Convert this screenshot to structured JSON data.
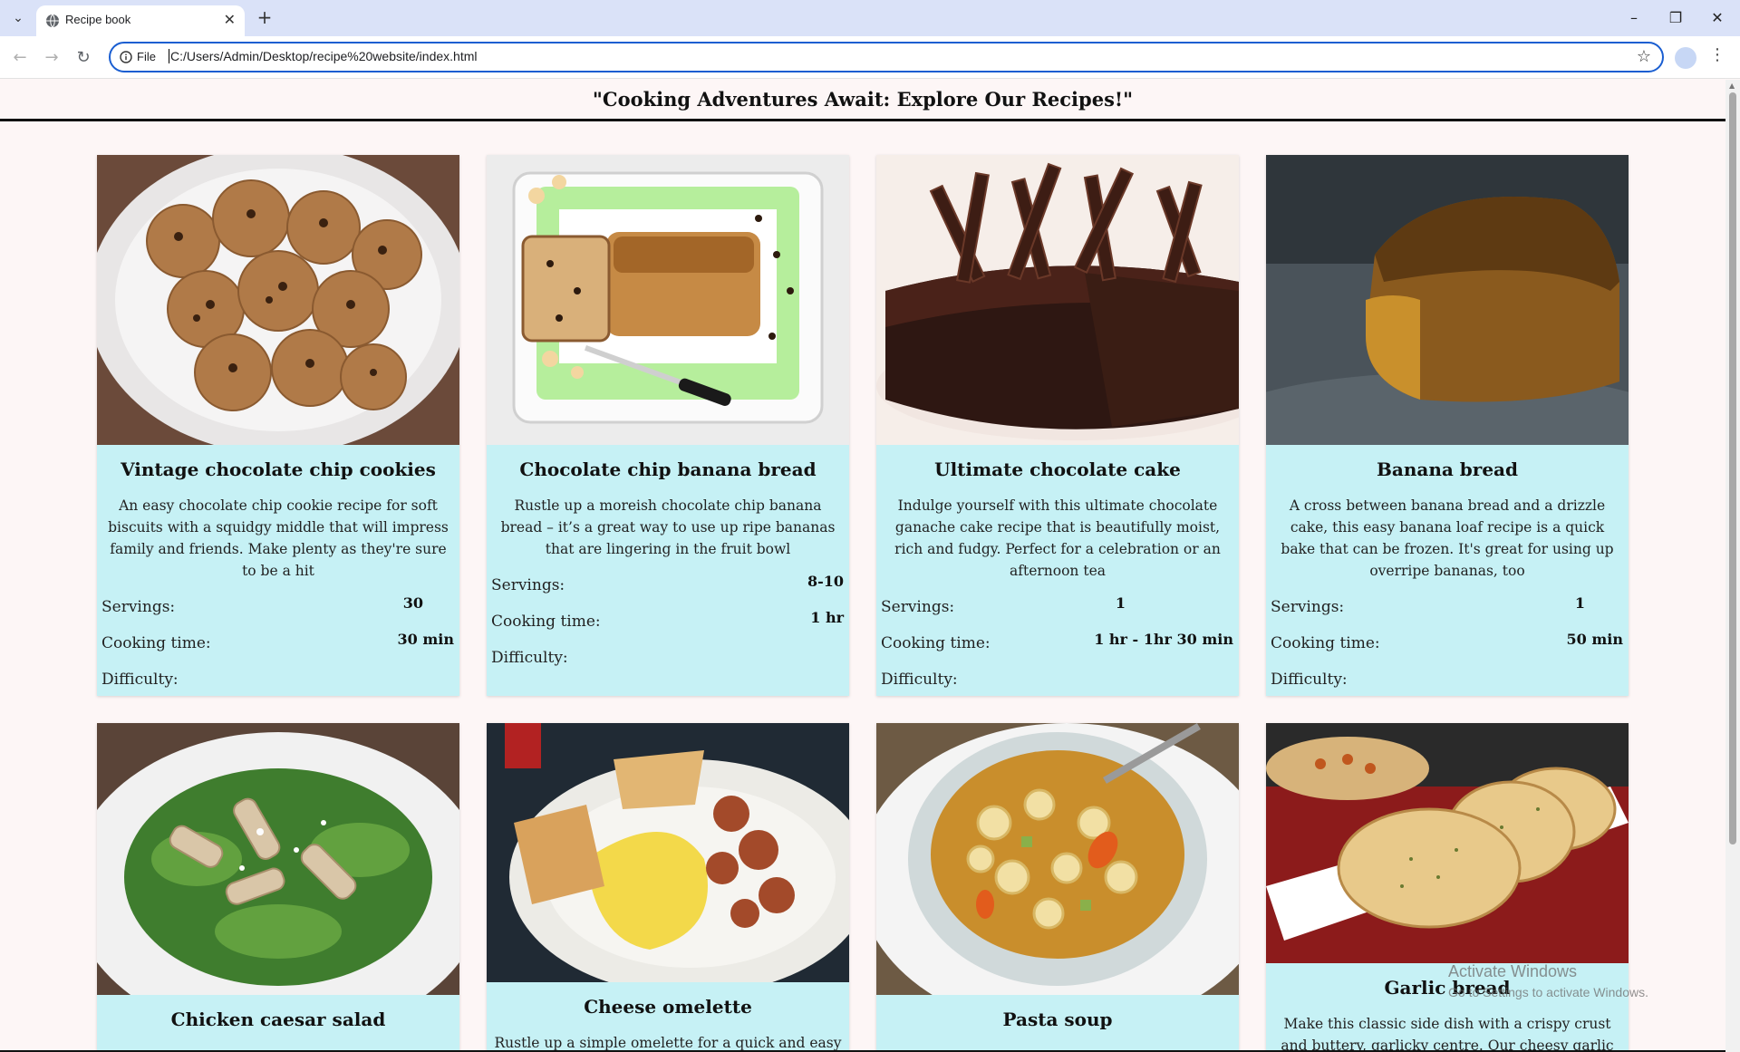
{
  "browser": {
    "tab_title": "Recipe book",
    "scheme_label": "File",
    "url": "C:/Users/Admin/Desktop/recipe%20website/index.html"
  },
  "site": {
    "title": "\"Cooking Adventures Await: Explore Our Recipes!\""
  },
  "labels": {
    "servings": "Servings:",
    "cooking_time": "Cooking time:",
    "difficulty": "Difficulty:"
  },
  "recipes": [
    {
      "title": "Vintage chocolate chip cookies",
      "description": "An easy chocolate chip cookie recipe for soft biscuits with a squidgy middle that will impress family and friends. Make plenty as they're sure to be a hit",
      "servings": "30",
      "cooking_time": "30 min",
      "image": "cookies-photo"
    },
    {
      "title": "Chocolate chip banana bread",
      "description": "Rustle up a moreish chocolate chip banana bread – it’s a great way to use up ripe bananas that are lingering in the fruit bowl",
      "servings": "8-10",
      "cooking_time": "1 hr",
      "image": "banana-bread-chocolate-photo"
    },
    {
      "title": "Ultimate chocolate cake",
      "description": "Indulge yourself with this ultimate chocolate ganache cake recipe that is beautifully moist, rich and fudgy. Perfect for a celebration or an afternoon tea",
      "servings": "1",
      "cooking_time": "1 hr - 1hr 30 min",
      "image": "chocolate-cake-photo"
    },
    {
      "title": "Banana bread",
      "description": "A cross between banana bread and a drizzle cake, this easy banana loaf recipe is a quick bake that can be frozen. It's great for using up overripe bananas, too",
      "servings": "1",
      "cooking_time": "50 min",
      "image": "banana-bread-photo"
    },
    {
      "title": "Chicken caesar salad",
      "image": "caesar-salad-photo"
    },
    {
      "title": "Cheese omelette",
      "description": "Rustle up a simple omelette for a quick and easy",
      "image": "omelette-photo"
    },
    {
      "title": "Pasta soup",
      "image": "pasta-soup-photo"
    },
    {
      "title": "Garlic bread",
      "description": "Make this classic side dish with a crispy crust and buttery, garlicky centre. Our cheesy garlic bread",
      "image": "garlic-bread-photo"
    }
  ],
  "watermark": {
    "line1": "Activate Windows",
    "line2": "Go to Settings to activate Windows."
  },
  "colors": {
    "card_bg": "#c6f1f5",
    "page_bg": "#fdf6f6",
    "tabbar_bg": "#dae2f8",
    "omnibox_border": "#1a5ed1"
  }
}
